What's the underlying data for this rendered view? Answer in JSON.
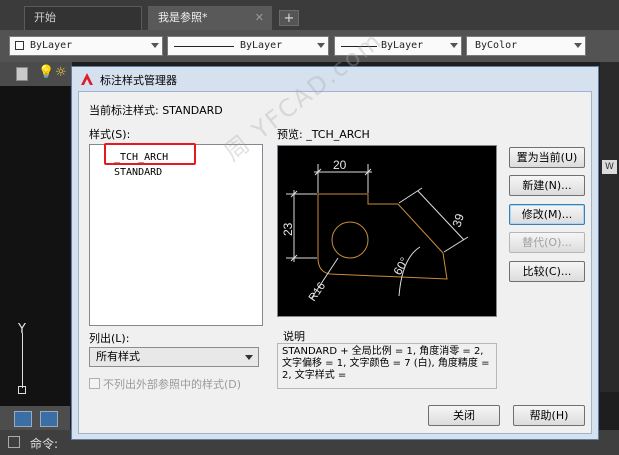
{
  "tabs": [
    {
      "label": "开始"
    },
    {
      "label": "我是参照*",
      "close": "✕"
    }
  ],
  "new_tab": "+",
  "toolbar": {
    "layer": "ByLayer",
    "linetype": "ByLayer",
    "lineweight": "ByLayer",
    "color": "ByColor"
  },
  "axis_label": "Y",
  "command_label": "命令:",
  "right_strip_text": "W",
  "dialog": {
    "title": "标注样式管理器",
    "current_style_label": "当前标注样式: STANDARD",
    "styles_label": "样式(S):",
    "styles": [
      "_TCH_ARCH",
      "STANDARD"
    ],
    "selected_style": "_TCH_ARCH",
    "preview_label": "预览: _TCH_ARCH",
    "buttons": {
      "set_current": "置为当前(U)",
      "new": "新建(N)...",
      "modify": "修改(M)...",
      "override": "替代(O)...",
      "compare": "比较(C)...",
      "close": "关闭",
      "help": "帮助(H)"
    },
    "list_label": "列出(L):",
    "list_value": "所有样式",
    "exclude_xref_label": "不列出外部参照中的样式(D)",
    "description_label": "说明",
    "description_text": "STANDARD + 全局比例 = 1, 角度消零 = 2, 文字偏移 = 1, 文字颜色 = 7 (白), 角度精度 = 2, 文字样式 ="
  },
  "preview_dims": {
    "top": "20",
    "left": "23",
    "right": "39",
    "angle": "60°",
    "radius": "R16"
  },
  "watermark": "周 YFCAD.com"
}
